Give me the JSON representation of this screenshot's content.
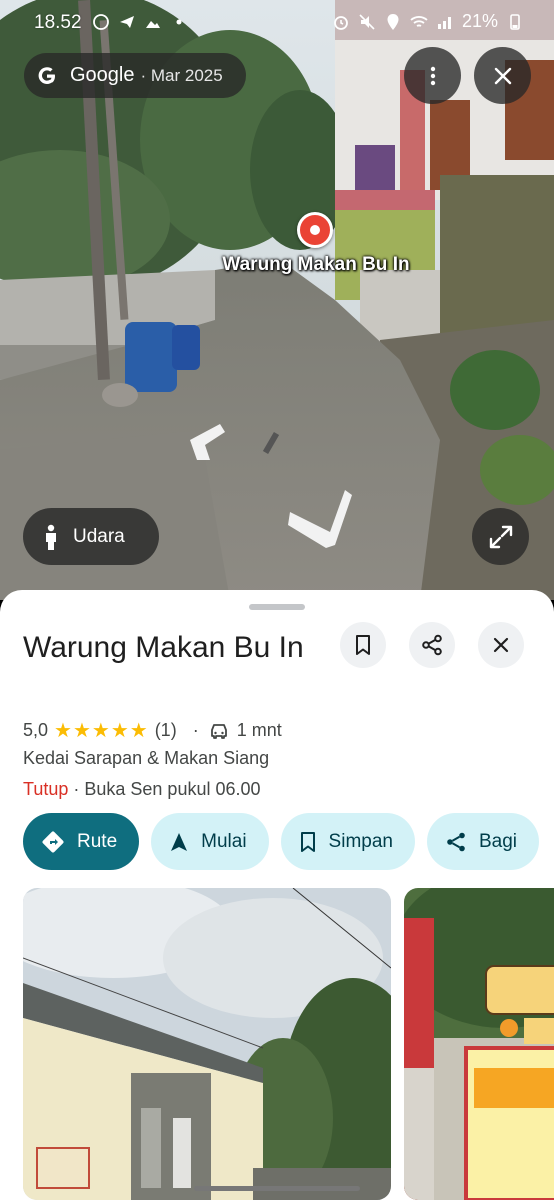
{
  "status_bar": {
    "time": "18.52",
    "battery": "21%"
  },
  "streetview": {
    "source_brand": "Google",
    "capture_date": "· Mar 2025",
    "place_label": "Warung Makan Bu In",
    "view_mode_label": "Udara"
  },
  "place": {
    "name": "Warung Makan Bu In",
    "rating": "5,0",
    "stars": "★★★★★",
    "review_count": "(1)",
    "separator": "·",
    "drive_time": "1 mnt",
    "category": "Kedai Sarapan & Makan Siang",
    "status": "Tutup",
    "hours": " · Buka Sen pukul 06.00"
  },
  "actions": [
    {
      "label": "Rute"
    },
    {
      "label": "Mulai"
    },
    {
      "label": "Simpan"
    },
    {
      "label": "Bagi"
    }
  ],
  "icons": {
    "save": "bookmark-icon",
    "share": "share-icon",
    "close": "close-icon",
    "more": "more-vert-icon",
    "expand": "expand-icon",
    "person": "person-icon",
    "car": "car-icon"
  },
  "colors": {
    "primary_teal": "#0f6e7f",
    "chip_tint": "#d3f2f7",
    "closed_red": "#d93025",
    "star_yellow": "#fbbc04",
    "pin_red": "#ea4335"
  }
}
